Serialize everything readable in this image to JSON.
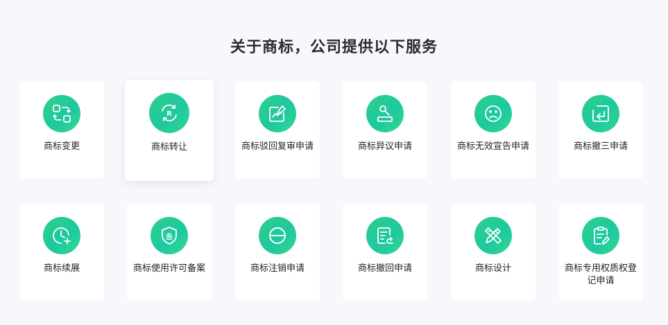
{
  "heading": "关于商标，公司提供以下服务",
  "accent_color": "#2dcf8e",
  "services": [
    {
      "label": "商标变更",
      "icon": "transfer-squares-icon"
    },
    {
      "label": "商标转让",
      "icon": "registered-cycle-icon"
    },
    {
      "label": "商标驳回复审申请",
      "icon": "chart-edit-icon"
    },
    {
      "label": "商标异议申请",
      "icon": "gavel-icon"
    },
    {
      "label": "商标无效宣告申请",
      "icon": "sad-face-icon"
    },
    {
      "label": "商标撤三申请",
      "icon": "return-arrow-icon"
    },
    {
      "label": "商标续展",
      "icon": "clock-plus-icon"
    },
    {
      "label": "商标使用许可备案",
      "icon": "shield-record-icon"
    },
    {
      "label": "商标注销申请",
      "icon": "minus-circle-icon"
    },
    {
      "label": "商标撤回申请",
      "icon": "document-return-icon"
    },
    {
      "label": "商标设计",
      "icon": "pencil-ruler-icon"
    },
    {
      "label": "商标专用权质权登记申请",
      "icon": "clipboard-edit-icon"
    }
  ]
}
